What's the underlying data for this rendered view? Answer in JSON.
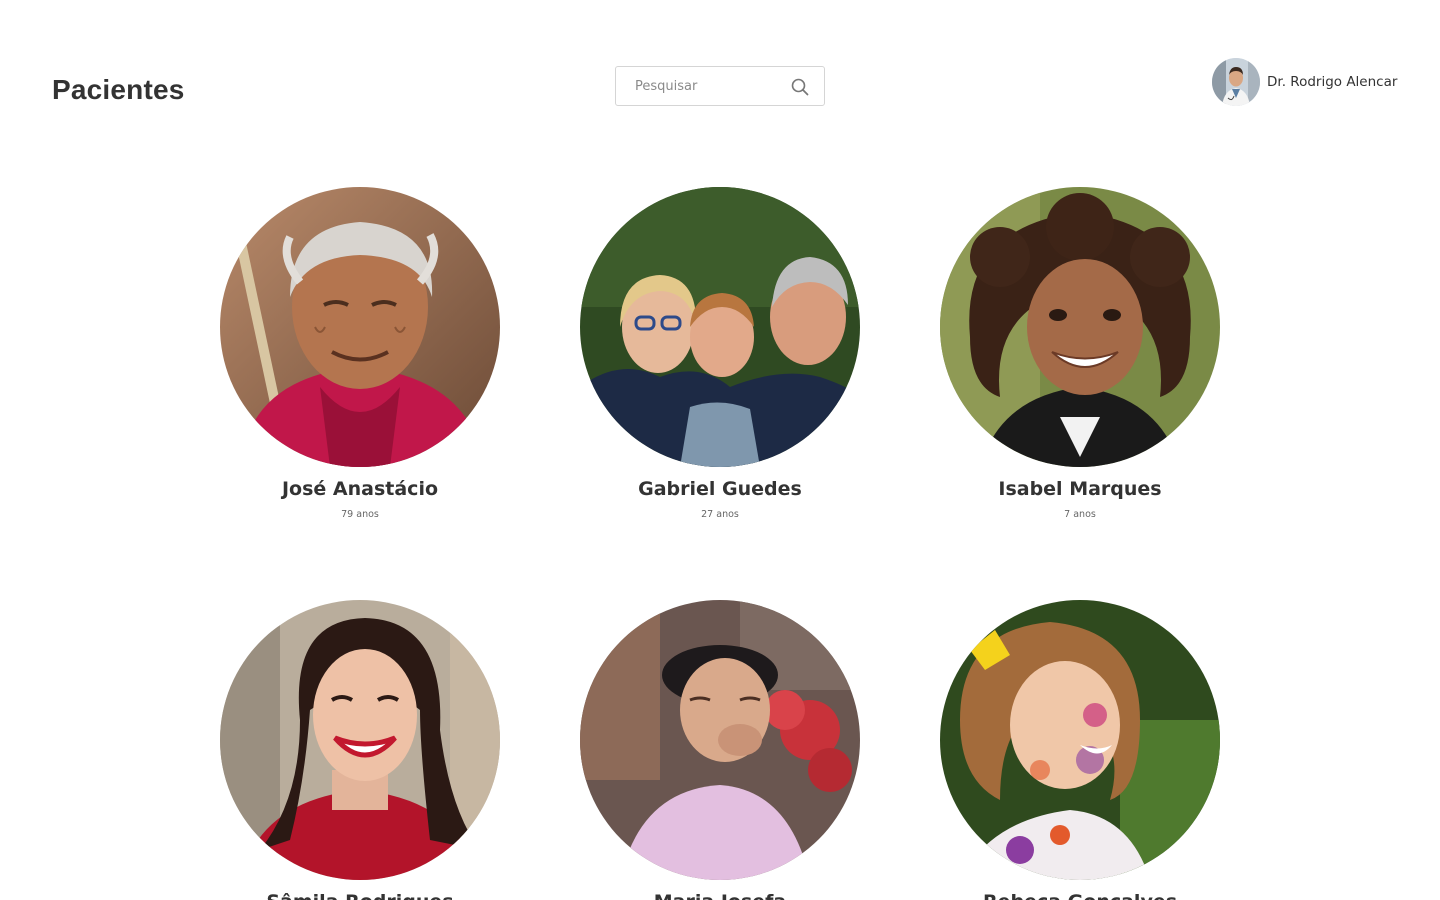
{
  "header": {
    "title": "Pacientes",
    "search": {
      "placeholder": "Pesquisar",
      "value": "",
      "icon": "search-icon"
    },
    "user": {
      "name": "Dr. Rodrigo Alencar"
    }
  },
  "patients": [
    {
      "name": "José Anastácio",
      "age": "79 anos"
    },
    {
      "name": "Gabriel Guedes",
      "age": "27 anos"
    },
    {
      "name": "Isabel Marques",
      "age": "7 anos"
    },
    {
      "name": "Sâmila Rodrigues",
      "age": ""
    },
    {
      "name": "Maria Josefa",
      "age": ""
    },
    {
      "name": "Rebeca Gonçalves",
      "age": ""
    }
  ],
  "colors": {
    "text": "#333333",
    "border": "#d5d5d5",
    "background": "#ffffff"
  }
}
